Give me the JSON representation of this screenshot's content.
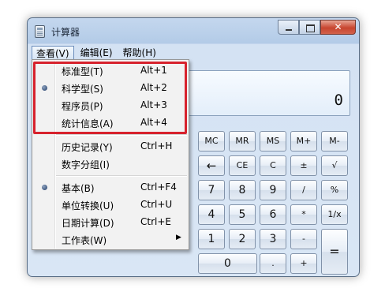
{
  "window": {
    "title": "计算器",
    "close_glyph": "✕"
  },
  "menubar": {
    "view": "查看(V)",
    "edit": "编辑(E)",
    "help": "帮助(H)"
  },
  "display": {
    "value": "0"
  },
  "view_menu": {
    "items": [
      {
        "label": "标准型(T)",
        "shortcut": "Alt+1",
        "checked": false
      },
      {
        "label": "科学型(S)",
        "shortcut": "Alt+2",
        "checked": true
      },
      {
        "label": "程序员(P)",
        "shortcut": "Alt+3",
        "checked": false
      },
      {
        "label": "统计信息(A)",
        "shortcut": "Alt+4",
        "checked": false
      },
      {
        "label": "历史记录(Y)",
        "shortcut": "Ctrl+H",
        "checked": false
      },
      {
        "label": "数字分组(I)",
        "shortcut": "",
        "checked": false
      },
      {
        "label": "基本(B)",
        "shortcut": "Ctrl+F4",
        "checked": true
      },
      {
        "label": "单位转换(U)",
        "shortcut": "Ctrl+U",
        "checked": false
      },
      {
        "label": "日期计算(D)",
        "shortcut": "Ctrl+E",
        "checked": false
      },
      {
        "label": "工作表(W)",
        "shortcut": "",
        "submenu": true
      }
    ]
  },
  "keypad": {
    "mc": "MC",
    "mr": "MR",
    "ms": "MS",
    "mplus": "M+",
    "mminus": "M-",
    "back": "←",
    "ce": "CE",
    "c": "C",
    "plusminus": "±",
    "sqrt": "√",
    "d7": "7",
    "d8": "8",
    "d9": "9",
    "divide": "/",
    "percent": "%",
    "d4": "4",
    "d5": "5",
    "d6": "6",
    "multiply": "*",
    "reciprocal": "1/x",
    "d1": "1",
    "d2": "2",
    "d3": "3",
    "minus": "-",
    "equals": "=",
    "d0": "0",
    "decimal": ".",
    "plus": "+"
  },
  "colors": {
    "highlight_box": "#d7222d",
    "window_frame": "#b3cbe7",
    "close_button": "#c7452f"
  }
}
